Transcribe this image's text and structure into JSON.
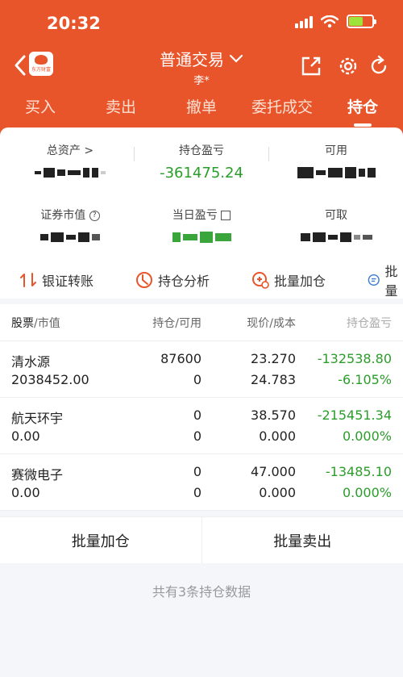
{
  "status_bar": {
    "time": "20:32"
  },
  "header": {
    "logo_text": "东方财富",
    "title": "普通交易",
    "account": "李*",
    "brand_color": "#e9552a"
  },
  "tabs": [
    {
      "label": "买入"
    },
    {
      "label": "卖出"
    },
    {
      "label": "撤单"
    },
    {
      "label": "委托成交"
    },
    {
      "label": "持仓",
      "active": true
    }
  ],
  "summary": {
    "total_assets_label": "总资产",
    "total_assets_arrow": ">",
    "position_pl_label": "持仓盈亏",
    "position_pl_value": "-361475.24",
    "available_label": "可用",
    "market_value_label": "证券市值",
    "daily_pl_label": "当日盈亏",
    "withdrawable_label": "可取"
  },
  "actions": [
    {
      "label": "银证转账",
      "icon": "transfer-icon"
    },
    {
      "label": "持仓分析",
      "icon": "clock-chart-icon"
    },
    {
      "label": "批量加仓",
      "icon": "add-coin-icon"
    },
    {
      "label": "批量",
      "icon": "list-icon"
    }
  ],
  "table": {
    "headers": {
      "stock": "股票",
      "market_value": "/市值",
      "position": "持仓",
      "available": "/可用",
      "price": "现价",
      "cost": "/成本",
      "pl": "持仓盈亏"
    },
    "rows": [
      {
        "name": "清水源",
        "market_value": "2038452.00",
        "position": "87600",
        "available": "0",
        "price": "23.270",
        "cost": "24.783",
        "pl": "-132538.80",
        "pl_pct": "-6.105%"
      },
      {
        "name": "航天环宇",
        "market_value": "0.00",
        "position": "0",
        "available": "0",
        "price": "38.570",
        "cost": "0.000",
        "pl": "-215451.34",
        "pl_pct": "0.000%"
      },
      {
        "name": "赛微电子",
        "market_value": "0.00",
        "position": "0",
        "available": "0",
        "price": "47.000",
        "cost": "0.000",
        "pl": "-13485.10",
        "pl_pct": "0.000%"
      }
    ]
  },
  "bottom": {
    "batch_add": "批量加仓",
    "batch_sell": "批量卖出",
    "footer": "共有3条持仓数据"
  },
  "colors": {
    "loss_green": "#2a9d2a",
    "accent": "#e9552a"
  }
}
